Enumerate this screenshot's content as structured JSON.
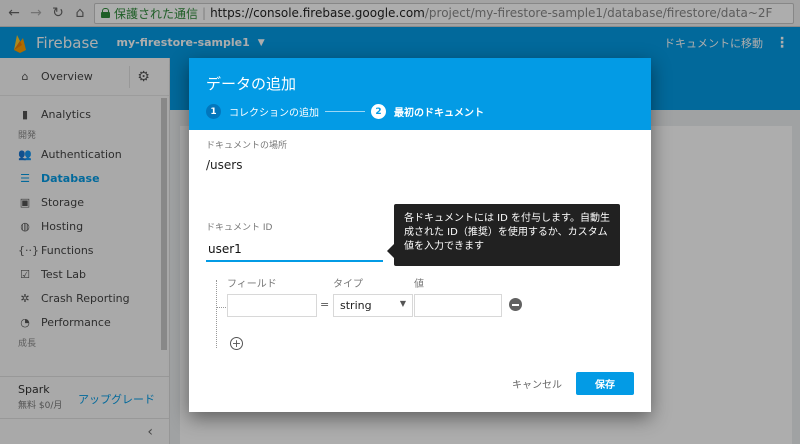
{
  "browser": {
    "secure_label": "保護された通信",
    "url_host": "https://console.firebase.google.com",
    "url_path": "/project/my-firestore-sample1/database/firestore/data~2F"
  },
  "header": {
    "brand": "Firebase",
    "project": "my-firestore-sample1",
    "doc_link": "ドキュメントに移動"
  },
  "sidebar": {
    "overview": "Overview",
    "items_top": [
      {
        "label": "Analytics",
        "icon": "bar-chart-icon"
      }
    ],
    "section_develop": "開発",
    "items_develop": [
      {
        "label": "Authentication",
        "icon": "users-icon"
      },
      {
        "label": "Database",
        "icon": "database-icon",
        "active": true
      },
      {
        "label": "Storage",
        "icon": "image-icon"
      },
      {
        "label": "Hosting",
        "icon": "globe-icon"
      },
      {
        "label": "Functions",
        "icon": "functions-icon"
      },
      {
        "label": "Test Lab",
        "icon": "checklist-icon"
      },
      {
        "label": "Crash Reporting",
        "icon": "gear-bug-icon"
      },
      {
        "label": "Performance",
        "icon": "speedometer-icon"
      }
    ],
    "section_grow": "成長",
    "plan_name": "Spark",
    "plan_price": "無料 $0/月",
    "upgrade": "アップグレード"
  },
  "modal": {
    "title": "データの追加",
    "step1_num": "1",
    "step1_label": "コレクションの追加",
    "step2_num": "2",
    "step2_label": "最初のドキュメント",
    "path_label": "ドキュメントの場所",
    "path_value": "/users",
    "docid_label": "ドキュメント ID",
    "docid_value": "user1",
    "tooltip": "各ドキュメントには ID を付与します。自動生成された ID（推奨）を使用するか、カスタム値を入力できます",
    "col_field": "フィールド",
    "col_type": "タイプ",
    "col_value": "値",
    "equals": "=",
    "type_selected": "string",
    "cancel": "キャンセル",
    "save": "保存"
  },
  "colors": {
    "accent": "#039be5",
    "tooltip_bg": "#212121"
  }
}
